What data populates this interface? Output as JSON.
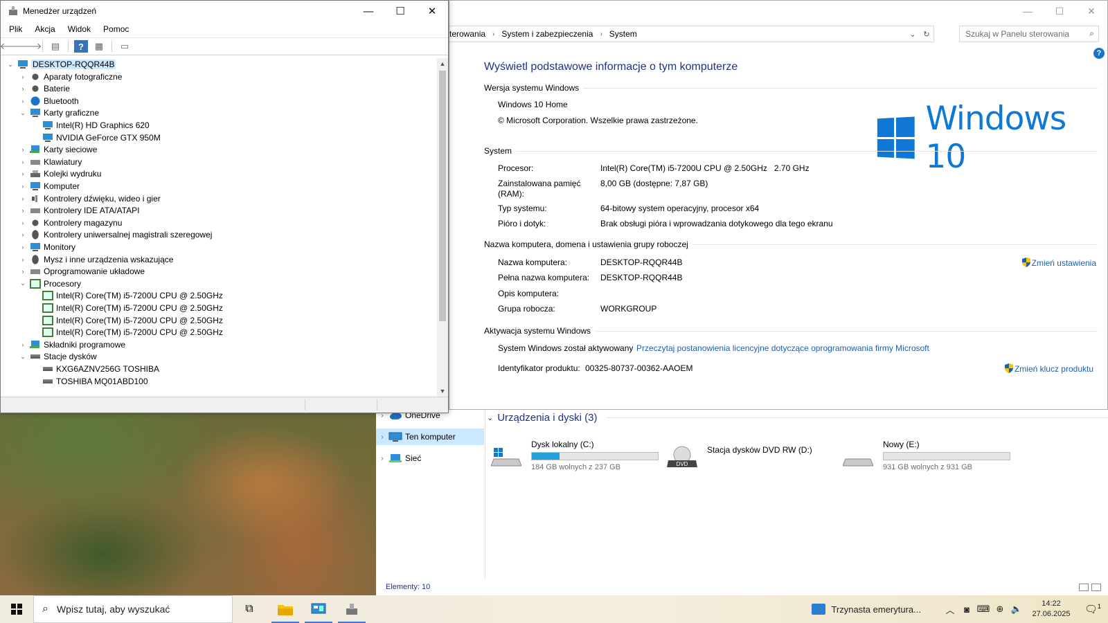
{
  "device_manager": {
    "title": "Menedżer urządzeń",
    "menu": [
      "Plik",
      "Akcja",
      "Widok",
      "Pomoc"
    ],
    "toolbar": [
      "back-icon",
      "forward-icon",
      "properties-icon",
      "help-icon",
      "view-icon",
      "monitor-icon"
    ],
    "tree": [
      {
        "label": "DESKTOP-RQQR44B",
        "level": 0,
        "expanded": true,
        "icon": "computer-icon",
        "root": true
      },
      {
        "label": "Aparaty fotograficzne",
        "level": 1,
        "expanded": false,
        "icon": "camera-icon"
      },
      {
        "label": "Baterie",
        "level": 1,
        "expanded": false,
        "icon": "battery-icon"
      },
      {
        "label": "Bluetooth",
        "level": 1,
        "expanded": false,
        "icon": "bluetooth-icon"
      },
      {
        "label": "Karty graficzne",
        "level": 1,
        "expanded": true,
        "icon": "display-adapter-icon"
      },
      {
        "label": "Intel(R) HD Graphics 620",
        "level": 2,
        "icon": "display-adapter-icon"
      },
      {
        "label": "NVIDIA GeForce GTX 950M",
        "level": 2,
        "icon": "display-adapter-icon"
      },
      {
        "label": "Karty sieciowe",
        "level": 1,
        "expanded": false,
        "icon": "network-adapter-icon"
      },
      {
        "label": "Klawiatury",
        "level": 1,
        "expanded": false,
        "icon": "keyboard-icon"
      },
      {
        "label": "Kolejki wydruku",
        "level": 1,
        "expanded": false,
        "icon": "printer-icon"
      },
      {
        "label": "Komputer",
        "level": 1,
        "expanded": false,
        "icon": "monitor-icon"
      },
      {
        "label": "Kontrolery dźwięku, wideo i gier",
        "level": 1,
        "expanded": false,
        "icon": "sound-icon"
      },
      {
        "label": "Kontrolery IDE ATA/ATAPI",
        "level": 1,
        "expanded": false,
        "icon": "ide-controller-icon"
      },
      {
        "label": "Kontrolery magazynu",
        "level": 1,
        "expanded": false,
        "icon": "storage-controller-icon"
      },
      {
        "label": "Kontrolery uniwersalnej magistrali szeregowej",
        "level": 1,
        "expanded": false,
        "icon": "usb-icon"
      },
      {
        "label": "Monitory",
        "level": 1,
        "expanded": false,
        "icon": "monitor-icon"
      },
      {
        "label": "Mysz i inne urządzenia wskazujące",
        "level": 1,
        "expanded": false,
        "icon": "mouse-icon"
      },
      {
        "label": "Oprogramowanie układowe",
        "level": 1,
        "expanded": false,
        "icon": "firmware-icon"
      },
      {
        "label": "Procesory",
        "level": 1,
        "expanded": true,
        "icon": "processor-icon"
      },
      {
        "label": "Intel(R) Core(TM) i5-7200U CPU @ 2.50GHz",
        "level": 2,
        "icon": "processor-icon"
      },
      {
        "label": "Intel(R) Core(TM) i5-7200U CPU @ 2.50GHz",
        "level": 2,
        "icon": "processor-icon"
      },
      {
        "label": "Intel(R) Core(TM) i5-7200U CPU @ 2.50GHz",
        "level": 2,
        "icon": "processor-icon"
      },
      {
        "label": "Intel(R) Core(TM) i5-7200U CPU @ 2.50GHz",
        "level": 2,
        "icon": "processor-icon"
      },
      {
        "label": "Składniki programowe",
        "level": 1,
        "expanded": false,
        "icon": "software-component-icon"
      },
      {
        "label": "Stacje dysków",
        "level": 1,
        "expanded": true,
        "icon": "disk-drive-icon"
      },
      {
        "label": "KXG6AZNV256G TOSHIBA",
        "level": 2,
        "icon": "disk-drive-icon"
      },
      {
        "label": "TOSHIBA MQ01ABD100",
        "level": 2,
        "icon": "disk-drive-icon"
      }
    ]
  },
  "system_window": {
    "breadcrumb": [
      "terowania",
      "System i zabezpieczenia",
      "System"
    ],
    "search_placeholder": "Szukaj w Panelu sterowania",
    "heading": "Wyświetl podstawowe informacje o tym komputerze",
    "edition_section": "Wersja systemu Windows",
    "edition": "Windows 10 Home",
    "copyright": "© Microsoft Corporation. Wszelkie prawa zastrzeżone.",
    "logo_text": "Windows 10",
    "system_section": "System",
    "processor_label": "Procesor:",
    "processor_value": "Intel(R) Core(TM) i5-7200U CPU @ 2.50GHz   2.70 GHz",
    "ram_label_1": "Zainstalowana pamięć",
    "ram_label_2": "(RAM):",
    "ram_value": "8,00 GB (dostępne: 7,87 GB)",
    "systype_label": "Typ systemu:",
    "systype_value": "64-bitowy system operacyjny, procesor x64",
    "pen_label": "Pióro i dotyk:",
    "pen_value": "Brak obsługi pióra i wprowadzania dotykowego dla tego ekranu",
    "name_section": "Nazwa komputera, domena i ustawienia grupy roboczej",
    "computer_name_label": "Nazwa komputera:",
    "computer_name_value": "DESKTOP-RQQR44B",
    "full_name_label": "Pełna nazwa komputera:",
    "full_name_value": "DESKTOP-RQQR44B",
    "description_label": "Opis komputera:",
    "workgroup_label": "Grupa robocza:",
    "workgroup_value": "WORKGROUP",
    "change_settings": "Zmień ustawienia",
    "activation_section": "Aktywacja systemu Windows",
    "activation_status": "System Windows został aktywowany",
    "license_link": "Przeczytaj postanowienia licencyjne dotyczące oprogramowania firmy Microsoft",
    "product_id_label": "Identyfikator produktu:",
    "product_id_value": "00325-80737-00362-AAOEM",
    "change_key": "Zmień klucz produktu"
  },
  "explorer": {
    "nav": [
      {
        "label": "OneDrive",
        "icon": "onedrive-icon",
        "selected": false
      },
      {
        "label": "Ten komputer",
        "icon": "this-pc-icon",
        "selected": true
      },
      {
        "label": "Sieć",
        "icon": "network-icon",
        "selected": false
      }
    ],
    "group_title": "Urządzenia i dyski (3)",
    "drives": [
      {
        "name": "Dysk lokalny (C:)",
        "free": "184 GB wolnych z 237 GB",
        "used_fraction": 0.22,
        "icon": "windows-drive-icon",
        "bar": true
      },
      {
        "name": "Stacja dysków DVD RW (D:)",
        "free": "",
        "icon": "dvd-drive-icon",
        "bar": false
      },
      {
        "name": "Nowy (E:)",
        "free": "931 GB wolnych z 931 GB",
        "used_fraction": 0.0,
        "icon": "drive-icon",
        "bar": true
      }
    ],
    "status": "Elementy: 10"
  },
  "taskbar": {
    "search_placeholder": "Wpisz tutaj, aby wyszukać",
    "news": "Trzynasta emerytura...",
    "time": "14:22",
    "date": "27.06.2025",
    "notification_count": "1"
  }
}
